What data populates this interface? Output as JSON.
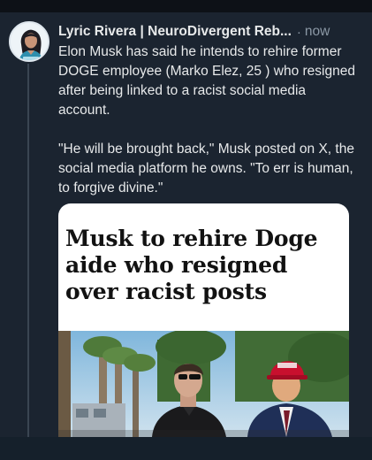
{
  "post": {
    "author_name": "Lyric Rivera | NeuroDivergent Reb...",
    "separator": "·",
    "timestamp": "now",
    "paragraphs": [
      "Elon Musk has said he intends to rehire former DOGE employee (Marko Elez, 25 ) who resigned after being linked to a racist social media account.",
      "\"He will be brought back,\" Musk posted on X, the social media platform he owns. \"To err is human, to forgive divine.\""
    ],
    "link_card": {
      "headline": "Musk to rehire Doge aide who resigned over racist posts"
    }
  },
  "icons": {
    "avatar": "user-avatar-icon"
  },
  "colors": {
    "background": "#1b2430",
    "text": "#e7e9ea",
    "muted": "#8b98a5",
    "card_bg": "#ffffff",
    "hat_red": "#c8102e"
  }
}
